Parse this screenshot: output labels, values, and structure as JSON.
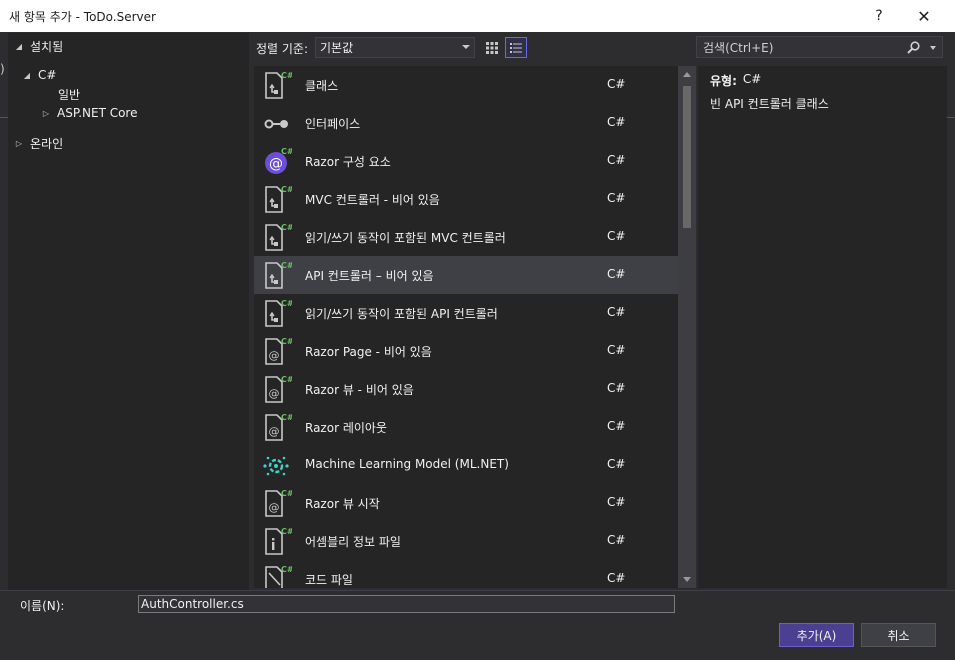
{
  "window": {
    "title": "새 항목 추가 - ToDo.Server",
    "help_glyph": "?",
    "close_glyph": "✕"
  },
  "tree": {
    "installed": "설치됨",
    "csharp": "C#",
    "general": "일반",
    "aspnet": "ASP.NET Core",
    "online": "온라인"
  },
  "toolbar": {
    "sort_label": "정렬 기준:",
    "sort_value": "기본값",
    "search_placeholder": "검색(Ctrl+E)"
  },
  "templates": [
    {
      "name": "클래스",
      "lang": "C#",
      "icon": "csharp-class-icon"
    },
    {
      "name": "인터페이스",
      "lang": "C#",
      "icon": "interface-icon"
    },
    {
      "name": "Razor 구성 요소",
      "lang": "C#",
      "icon": "razor-component-icon"
    },
    {
      "name": "MVC 컨트롤러 - 비어 있음",
      "lang": "C#",
      "icon": "csharp-file-icon"
    },
    {
      "name": "읽기/쓰기 동작이 포함된 MVC 컨트롤러",
      "lang": "C#",
      "icon": "csharp-file-icon"
    },
    {
      "name": "API 컨트롤러 – 비어 있음",
      "lang": "C#",
      "icon": "csharp-file-icon"
    },
    {
      "name": "읽기/쓰기 동작이 포함된 API 컨트롤러",
      "lang": "C#",
      "icon": "csharp-file-icon"
    },
    {
      "name": "Razor Page - 비어 있음",
      "lang": "C#",
      "icon": "razor-page-icon"
    },
    {
      "name": "Razor 뷰 - 비어 있음",
      "lang": "C#",
      "icon": "razor-page-icon"
    },
    {
      "name": "Razor 레이아웃",
      "lang": "C#",
      "icon": "razor-page-icon"
    },
    {
      "name": "Machine Learning Model (ML.NET)",
      "lang": "C#",
      "icon": "mlnet-icon"
    },
    {
      "name": "Razor 뷰 시작",
      "lang": "C#",
      "icon": "razor-page-icon"
    },
    {
      "name": "어셈블리 정보 파일",
      "lang": "C#",
      "icon": "assembly-info-icon"
    },
    {
      "name": "코드 파일",
      "lang": "C#",
      "icon": "code-file-icon"
    }
  ],
  "selected_index": 5,
  "details": {
    "type_label": "유형:",
    "type_value": "C#",
    "description": "빈 API 컨트롤러 클래스"
  },
  "footer": {
    "name_label": "이름(N):",
    "name_value": "AuthController.cs",
    "add_label": "추가(A)",
    "cancel_label": "취소"
  },
  "colors": {
    "accent": "#4b3f91",
    "csharp_badge": "#68c164",
    "razor": "#8a6df0",
    "mlnet": "#3fd0c9"
  }
}
